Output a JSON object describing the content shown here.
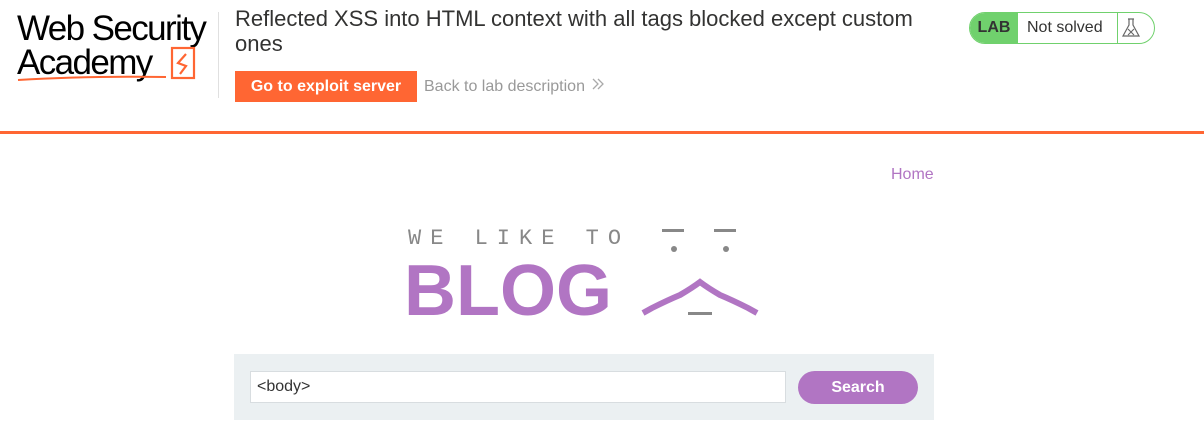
{
  "header": {
    "logo_line1": "Web Security",
    "logo_line2": "Academy",
    "lab_title": "Reflected XSS into HTML context with all tags blocked except custom ones",
    "exploit_button_label": "Go to exploit server",
    "back_link_label": "Back to lab description",
    "lab_badge": "LAB",
    "lab_status": "Not solved",
    "icons": {
      "back_chevron": "double-chevron-right-icon",
      "status": "flask-icon"
    }
  },
  "colors": {
    "accent_orange": "#ff6633",
    "status_green": "#70d16d",
    "blog_purple": "#b175c3",
    "banner_grey": "#888888",
    "search_panel": "#ebf0f2"
  },
  "nav": {
    "home_label": "Home"
  },
  "banner": {
    "tagline": "WE LIKE TO",
    "word": "BLOG"
  },
  "search": {
    "value": "<body>",
    "button_label": "Search"
  }
}
